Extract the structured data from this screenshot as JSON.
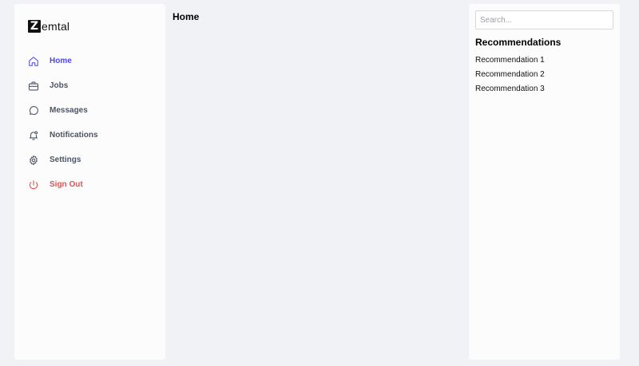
{
  "brand": {
    "logo_letter": "Z",
    "logo_text": "emtal"
  },
  "sidebar": {
    "items": [
      {
        "label": "Home",
        "icon": "home-icon",
        "state": "active"
      },
      {
        "label": "Jobs",
        "icon": "briefcase-icon"
      },
      {
        "label": "Messages",
        "icon": "chat-bubble-icon"
      },
      {
        "label": "Notifications",
        "icon": "bell-icon"
      },
      {
        "label": "Settings",
        "icon": "gear-icon"
      },
      {
        "label": "Sign Out",
        "icon": "power-icon",
        "state": "danger"
      }
    ]
  },
  "main": {
    "title": "Home"
  },
  "right_panel": {
    "search": {
      "placeholder": "Search...",
      "value": ""
    },
    "title": "Recommendations",
    "items": [
      {
        "label": "Recommendation 1"
      },
      {
        "label": "Recommendation 2"
      },
      {
        "label": "Recommendation 3"
      }
    ]
  },
  "colors": {
    "page_background": "#f1f2f6",
    "panel_background": "#fcfcfc",
    "accent": "#4f46e5",
    "danger": "#e05555",
    "muted_text": "#4b5563"
  }
}
